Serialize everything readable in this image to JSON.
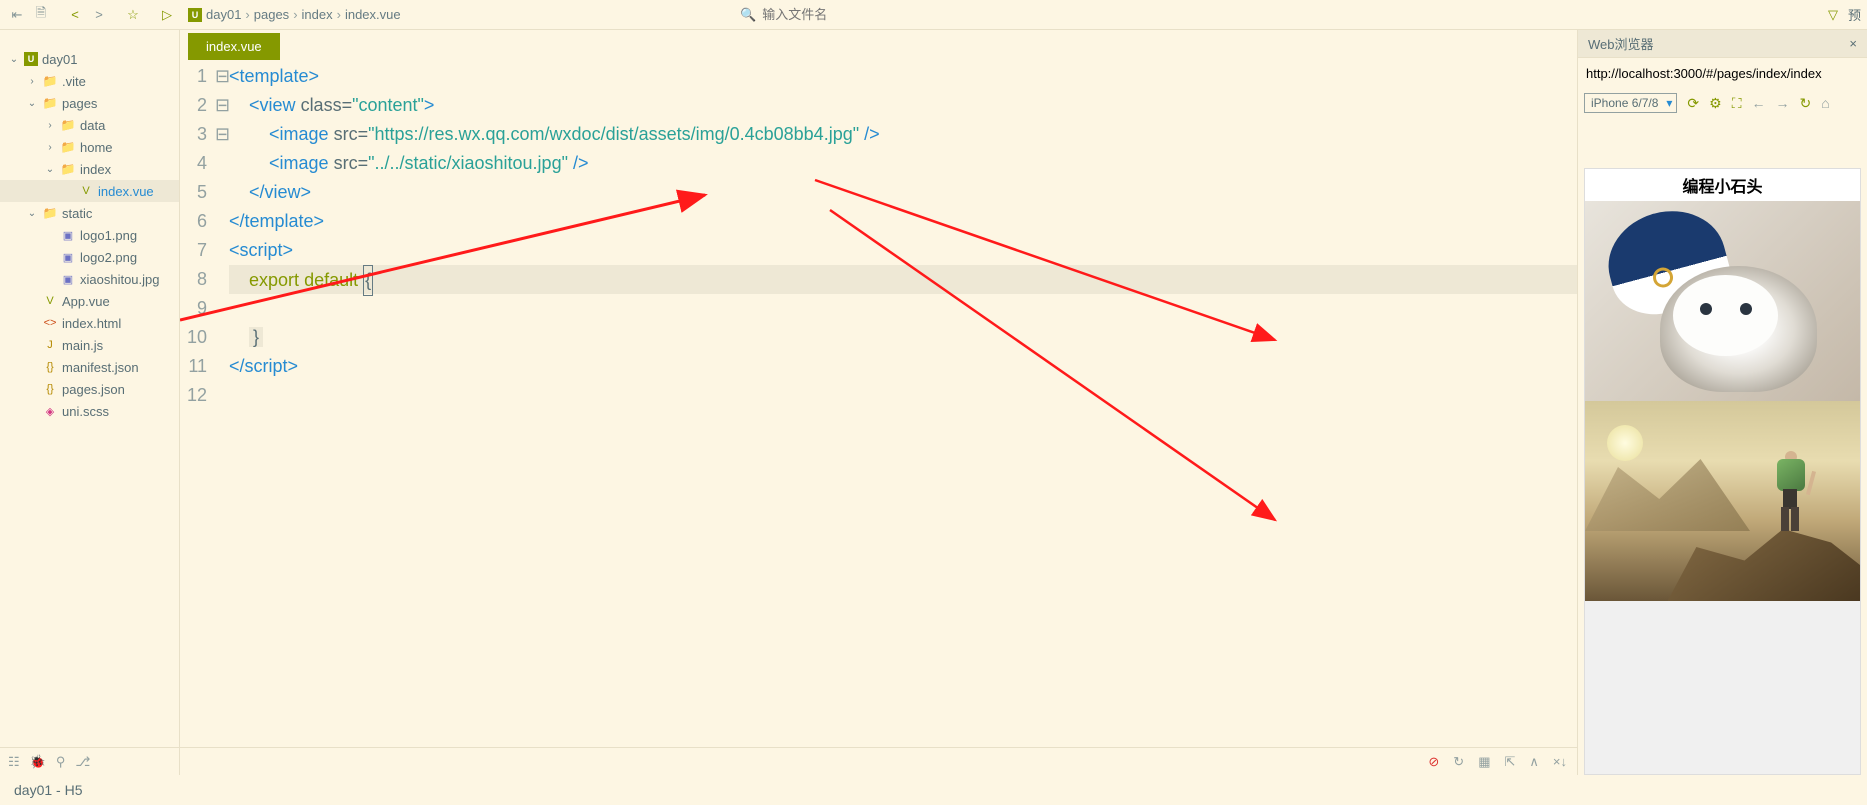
{
  "toolbar": {
    "search_placeholder": "输入文件名",
    "right_label": "预"
  },
  "breadcrumb": [
    "day01",
    "pages",
    "index",
    "index.vue"
  ],
  "sidebar": {
    "tree": [
      {
        "depth": 0,
        "type": "project",
        "label": "day01",
        "open": true
      },
      {
        "depth": 1,
        "type": "folder",
        "label": ".vite",
        "open": false
      },
      {
        "depth": 1,
        "type": "folder",
        "label": "pages",
        "open": true
      },
      {
        "depth": 2,
        "type": "folder",
        "label": "data",
        "open": false
      },
      {
        "depth": 2,
        "type": "folder",
        "label": "home",
        "open": false
      },
      {
        "depth": 2,
        "type": "folder",
        "label": "index",
        "open": true
      },
      {
        "depth": 3,
        "type": "vue",
        "label": "index.vue",
        "selected": true
      },
      {
        "depth": 1,
        "type": "folder",
        "label": "static",
        "open": true
      },
      {
        "depth": 2,
        "type": "img",
        "label": "logo1.png"
      },
      {
        "depth": 2,
        "type": "img",
        "label": "logo2.png"
      },
      {
        "depth": 2,
        "type": "img",
        "label": "xiaoshitou.jpg"
      },
      {
        "depth": 1,
        "type": "vue",
        "label": "App.vue"
      },
      {
        "depth": 1,
        "type": "html",
        "label": "index.html"
      },
      {
        "depth": 1,
        "type": "js",
        "label": "main.js"
      },
      {
        "depth": 1,
        "type": "json",
        "label": "manifest.json"
      },
      {
        "depth": 1,
        "type": "json",
        "label": "pages.json"
      },
      {
        "depth": 1,
        "type": "scss",
        "label": "uni.scss"
      }
    ]
  },
  "editor": {
    "tab_label": "index.vue",
    "lines": [
      {
        "n": 1,
        "fold": "⊟",
        "html": "<span class='tag'>&lt;template&gt;</span>"
      },
      {
        "n": 2,
        "fold": "⊟",
        "html": "    <span class='tag'>&lt;view</span> <span class='attr'>class=</span><span class='str'>\"content\"</span><span class='tag'>&gt;</span>"
      },
      {
        "n": 3,
        "fold": "",
        "html": "        <span class='tag'>&lt;image</span> <span class='attr'>src=</span><span class='str'>\"https://res.wx.qq.com/wxdoc/dist/assets/img/0.4cb08bb4.jpg\"</span> <span class='tag'>/&gt;</span>"
      },
      {
        "n": 4,
        "fold": "",
        "html": "        <span class='tag'>&lt;image</span> <span class='attr'>src=</span><span class='str'>\"../../static/xiaoshitou.jpg\"</span> <span class='tag'>/&gt;</span>"
      },
      {
        "n": 5,
        "fold": "",
        "html": "    <span class='tag'>&lt;/view&gt;</span>"
      },
      {
        "n": 6,
        "fold": "",
        "html": "<span class='tag'>&lt;/template&gt;</span>"
      },
      {
        "n": 7,
        "fold": "⊟",
        "html": "<span class='tag'>&lt;script&gt;</span>"
      },
      {
        "n": 8,
        "fold": "",
        "hl": true,
        "html": "    <span class='kw'>export</span> <span class='kw'>default</span> <span class='cursor-box txt'>{</span>"
      },
      {
        "n": 9,
        "fold": "",
        "html": ""
      },
      {
        "n": 10,
        "fold": "",
        "html": "    <span class='txt' style='background:#eee8d5;padding:0 4px'>}</span>"
      },
      {
        "n": 11,
        "fold": "",
        "html": "<span class='tag'>&lt;/script&gt;</span>"
      },
      {
        "n": 12,
        "fold": "",
        "html": ""
      }
    ]
  },
  "preview": {
    "tab_label": "Web浏览器",
    "url": "http://localhost:3000/#/pages/index/index",
    "device": "iPhone 6/7/8",
    "page_title": "编程小石头"
  },
  "status": {
    "left": "day01 - H5"
  }
}
